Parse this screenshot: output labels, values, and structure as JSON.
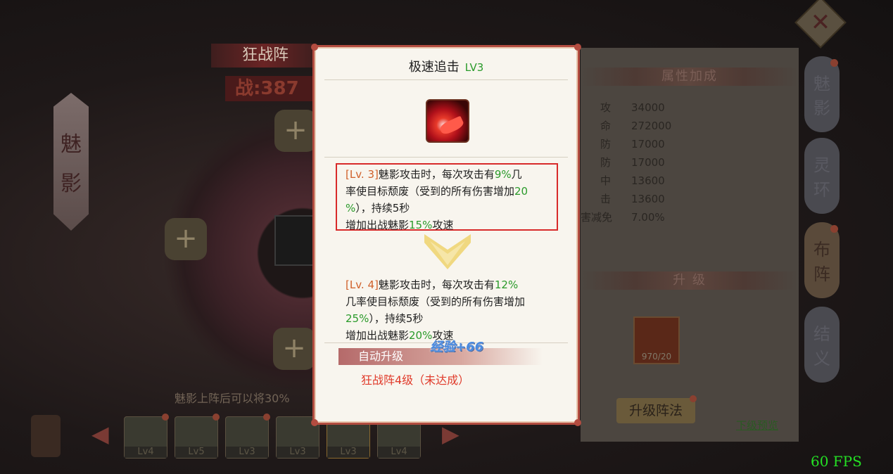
{
  "scene": {
    "formation_title": "狂战阵",
    "power_text": "战:387",
    "character_name_chars": [
      "魅",
      "影"
    ],
    "bottom_hint": "魅影上阵后可以将30%",
    "slots": [
      {
        "level": "Lv4"
      },
      {
        "level": "Lv5"
      },
      {
        "level": "Lv3"
      },
      {
        "level": "Lv3"
      },
      {
        "level": "Lv3"
      },
      {
        "level": "Lv4"
      }
    ],
    "plus_glyph": "+"
  },
  "attributes": {
    "header": "属性加成",
    "rows": [
      {
        "key": "攻",
        "value": "34000"
      },
      {
        "key": "命",
        "value": "272000"
      },
      {
        "key": "防",
        "value": "17000"
      },
      {
        "key": "防",
        "value": "17000"
      },
      {
        "key": "中",
        "value": "13600"
      },
      {
        "key": "击",
        "value": "13600"
      },
      {
        "key": "害减免",
        "value": "7.00%"
      }
    ]
  },
  "upgrade": {
    "header": "升 级",
    "item_count": "970/20",
    "button": "升级阵法",
    "preview_link": "下级预览"
  },
  "tabs": [
    {
      "label": [
        "魅",
        "影"
      ],
      "badge": true
    },
    {
      "label": [
        "灵",
        "环"
      ],
      "badge": false
    },
    {
      "label": [
        "布",
        "阵"
      ],
      "badge": true,
      "active": true
    },
    {
      "label": [
        "结",
        "义"
      ],
      "badge": false
    }
  ],
  "close_glyph": "✕",
  "fps": "60 FPS",
  "popup": {
    "title": "极速追击",
    "level": "LV3",
    "current": {
      "tag": "[Lv. 3]",
      "line1_a": "魅影攻击时，每次攻击有",
      "line1_b": "9%",
      "line1_c": "几",
      "line2_a": "率使目标颓废（受到的所有伤害增加",
      "line2_b": "20",
      "line3_a": "%",
      "line3_b": "），持续5秒",
      "line4_a": "增加出战魅影",
      "line4_b": "15%",
      "line4_c": "攻速"
    },
    "next": {
      "tag": "[Lv. 4]",
      "line1_a": "魅影攻击时，每次攻击有",
      "line1_b": "12%",
      "line2": "几率使目标颓废（受到的所有伤害增加",
      "line3_a": "25%",
      "line3_b": "），持续5秒",
      "line4_a": "增加出战魅影",
      "line4_b": "20%",
      "line4_c": "攻速"
    },
    "exp_float": "经验+66",
    "auto_upgrade_label": "自动升级",
    "auto_upgrade_condition": "狂战阵4级（未达成）"
  }
}
